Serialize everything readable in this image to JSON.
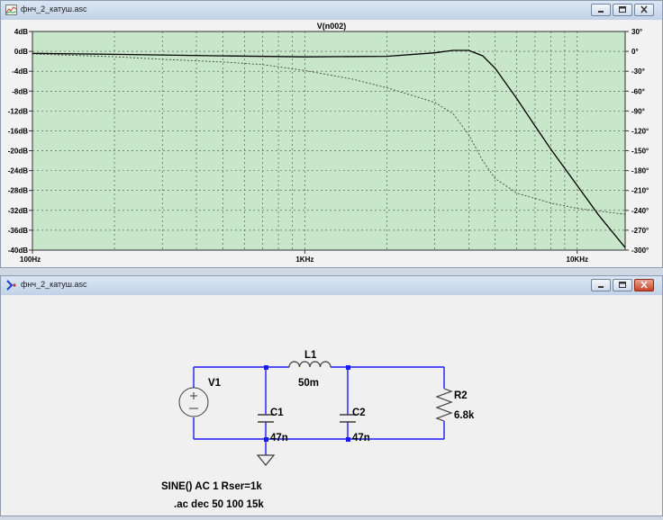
{
  "plot_window": {
    "title": "фнч_2_катуш.asc",
    "trace_label": "V(n002)"
  },
  "schematic_window": {
    "title": "фнч_2_катуш.asc",
    "components": {
      "v1": {
        "name": "V1"
      },
      "l1": {
        "name": "L1",
        "value": "50m"
      },
      "c1": {
        "name": "C1",
        "value": "47n"
      },
      "c2": {
        "name": "C2",
        "value": "47n"
      },
      "r2": {
        "name": "R2",
        "value": "6.8k"
      }
    },
    "directives": {
      "source": "SINE() AC 1  Rser=1k",
      "analysis": ".ac dec 50 100 15k"
    }
  },
  "colors": {
    "plot_bg": "#c8e6c9",
    "grid": "#4a4a4a",
    "wire": "#1a1aff",
    "component": "#3c3c3c",
    "magnitude_trace": "#000000",
    "phase_trace": "#444444"
  },
  "chart_data": {
    "type": "line",
    "title": "V(n002)",
    "x_scale": "log",
    "xlim": [
      100,
      15000
    ],
    "x_ticks": [
      "100Hz",
      "1KHz",
      "10KHz"
    ],
    "left_axis": {
      "unit": "dB",
      "ylim": [
        -40,
        4
      ],
      "ticks": [
        "4dB",
        "0dB",
        "-4dB",
        "-8dB",
        "-12dB",
        "-16dB",
        "-20dB",
        "-24dB",
        "-28dB",
        "-32dB",
        "-36dB",
        "-40dB"
      ]
    },
    "right_axis": {
      "unit": "°",
      "ylim": [
        -300,
        30
      ],
      "ticks": [
        "30°",
        "0°",
        "-30°",
        "-60°",
        "-90°",
        "-120°",
        "-150°",
        "-180°",
        "-210°",
        "-240°",
        "-270°",
        "-300°"
      ]
    },
    "grid": true,
    "series": [
      {
        "style": "solid",
        "axis": "left",
        "x": [
          100,
          200,
          500,
          1000,
          2000,
          3000,
          3500,
          4000,
          4500,
          5000,
          6000,
          7000,
          8000,
          10000,
          12000,
          15000
        ],
        "y": [
          -0.4,
          -0.6,
          -0.9,
          -1.1,
          -1.0,
          -0.3,
          0.2,
          0.2,
          -0.9,
          -3.4,
          -9.5,
          -15,
          -19.7,
          -27,
          -33,
          -39.5
        ]
      },
      {
        "style": "dashed",
        "axis": "right",
        "x": [
          100,
          200,
          300,
          500,
          700,
          1000,
          1500,
          2000,
          2500,
          3000,
          3500,
          4000,
          4500,
          5000,
          6000,
          8000,
          10000,
          12000,
          15000
        ],
        "y": [
          -4,
          -8,
          -12,
          -16,
          -20,
          -29,
          -42,
          -55,
          -67,
          -77,
          -94,
          -126,
          -165,
          -192,
          -214,
          -229,
          -237,
          -241,
          -246
        ]
      }
    ]
  }
}
